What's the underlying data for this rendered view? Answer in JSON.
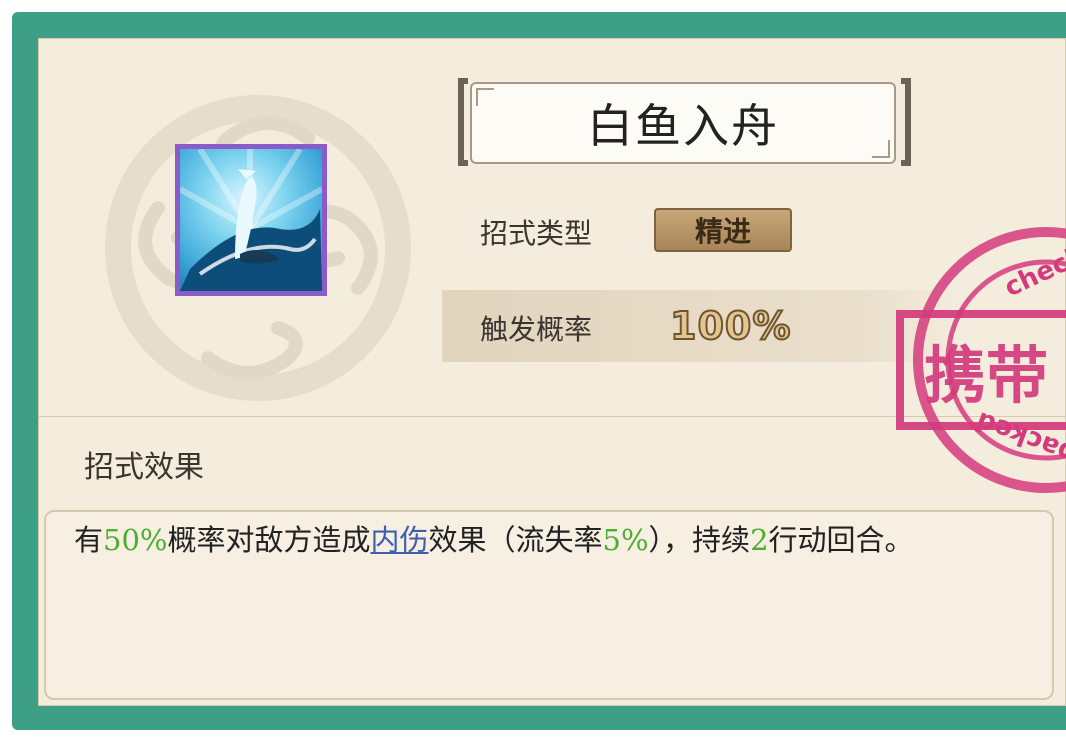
{
  "skill": {
    "name": "白鱼入舟",
    "type_label": "招式类型",
    "type_value": "精进",
    "rate_label": "触发概率",
    "rate_value": "100%",
    "effect_title": "招式效果",
    "effect": {
      "p1": "有",
      "v1": "50%",
      "p2": "概率对敌方造成",
      "link": "内伤",
      "p3": "效果（流失率",
      "v2": "5%",
      "p4": "），持续",
      "v3": "2",
      "p5": "行动回合。"
    }
  },
  "stamp": {
    "label": "携带",
    "ring_text_top": "check",
    "ring_text_bottom": "packed"
  },
  "colors": {
    "frame": "#3d9f86",
    "panel": "#f4ecdd",
    "highlight_green": "#4fae2f",
    "link_blue": "#3d5fb0",
    "stamp": "#d33b7d",
    "icon_border": "#8b5cc9"
  },
  "icons": {
    "skill_icon": "leaping-fish-icon",
    "background_ornament": "cloud-swirl-icon"
  }
}
